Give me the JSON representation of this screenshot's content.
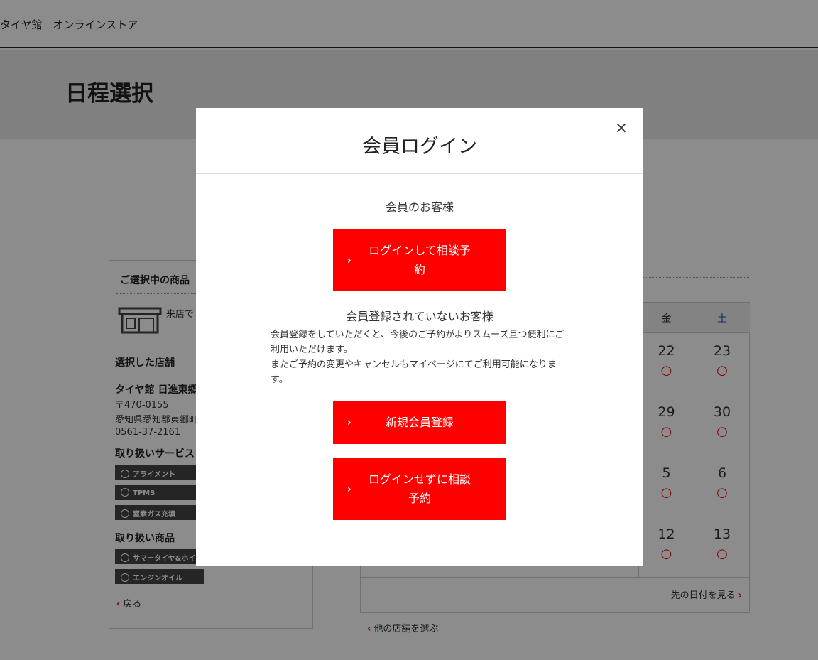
{
  "header": {
    "logo": "タイヤ館　オンラインストア"
  },
  "page": {
    "title": "日程選択"
  },
  "sidebar": {
    "heading": "ご選択中の商品",
    "store_type": "来店で",
    "selected_store_heading": "選択した店舗",
    "store_name": "タイヤ館 日進東郷",
    "postal": "〒470-0155",
    "address": "愛知県愛知郡東郷町",
    "phone": "0561-37-2161",
    "services_heading": "取り扱いサービス",
    "services": [
      "アライメント",
      "TPMS",
      "窒素ガス充填"
    ],
    "products_heading": "取り扱い商品",
    "products": [
      "サマータイヤ&ホイールセット",
      "エンジンオイル"
    ],
    "back": "戻る"
  },
  "calendar": {
    "headers": {
      "fri": "金",
      "sat": "土"
    },
    "rows": [
      {
        "fri": "22",
        "sat": "23"
      },
      {
        "fri": "29",
        "sat": "30"
      },
      {
        "fri": "5",
        "sat": "6"
      },
      {
        "fri": "12",
        "sat": "13"
      }
    ],
    "available_mark": "○",
    "more_dates": "先の日付を見る",
    "other_store": "他の店舗を選ぶ"
  },
  "modal": {
    "title": "会員ログイン",
    "close": "×",
    "member_heading": "会員のお客様",
    "login_button": "ログインして相談予約",
    "non_member_heading": "会員登録されていないお客様",
    "description": "会員登録をしていただくと、今後のご予約がよりスムーズ且つ便利にご利用いただけます。\nまたご予約の変更やキャンセルもマイページにてご利用可能になります。",
    "register_button": "新規会員登録",
    "guest_button": "ログインせずに相談予約",
    "arrow": "›"
  },
  "colors": {
    "accent": "#ff0000",
    "overlay": "rgba(0,0,0,0.45)"
  }
}
